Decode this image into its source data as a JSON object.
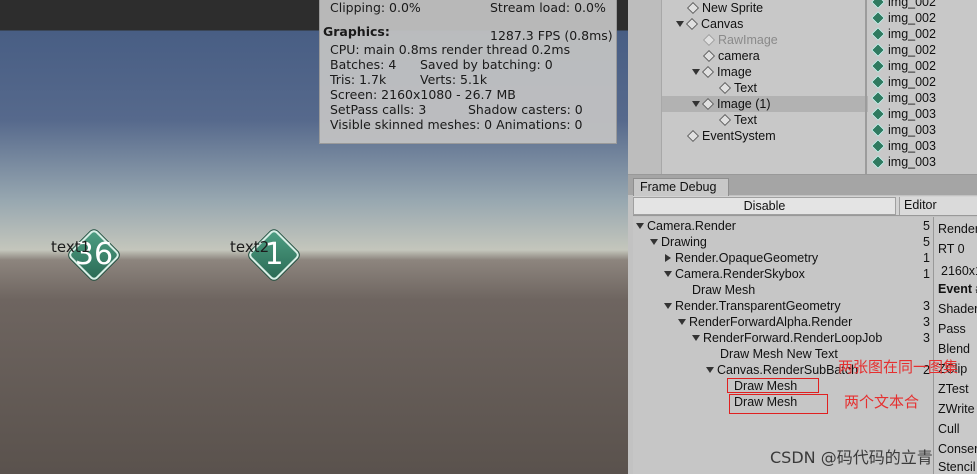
{
  "game": {
    "objects": [
      {
        "label": "text1",
        "number": "36"
      },
      {
        "label": "text2",
        "number": "1"
      }
    ],
    "stats": {
      "clipping": "Clipping: 0.0%",
      "stream_load": "Stream load: 0.0%",
      "heading": "Graphics:",
      "fps": "1287.3 FPS (0.8ms)",
      "cpu": "CPU: main 0.8ms  render thread 0.2ms",
      "batches": "Batches: 4",
      "saved_batching": "Saved by batching: 0",
      "tris": "Tris: 1.7k",
      "verts": "Verts: 5.1k",
      "screen": "Screen: 2160x1080 - 26.7 MB",
      "setpass": "SetPass calls: 3",
      "shadow_casters": "Shadow casters: 0",
      "skinned": "Visible skinned meshes: 0  Animations: 0"
    }
  },
  "hierarchy": {
    "items": [
      {
        "label": "New Sprite",
        "expand": "none",
        "dim": false
      },
      {
        "label": "Canvas",
        "expand": "open",
        "dim": false
      },
      {
        "label": "RawImage",
        "expand": "none",
        "dim": true
      },
      {
        "label": "camera",
        "expand": "none",
        "dim": false
      },
      {
        "label": "Image",
        "expand": "open",
        "dim": false
      },
      {
        "label": "Text",
        "expand": "none",
        "dim": false
      },
      {
        "label": "Image (1)",
        "expand": "open",
        "dim": false
      },
      {
        "label": "Text",
        "expand": "none",
        "dim": false
      },
      {
        "label": "EventSystem",
        "expand": "none",
        "dim": false
      }
    ],
    "assets": [
      "img_002",
      "img_002",
      "img_002",
      "img_002",
      "img_002",
      "img_002",
      "img_003",
      "img_003",
      "img_003",
      "img_003",
      "img_003"
    ]
  },
  "frame_debug": {
    "tab": "Frame Debug",
    "disable_label": "Disable",
    "editor_label": "Editor",
    "tree": [
      {
        "label": "Camera.Render",
        "count": "5",
        "expand": "open"
      },
      {
        "label": "Drawing",
        "count": "5",
        "expand": "open"
      },
      {
        "label": "Render.OpaqueGeometry",
        "count": "1",
        "expand": "closed"
      },
      {
        "label": "Camera.RenderSkybox",
        "count": "1",
        "expand": "open"
      },
      {
        "label": "Draw Mesh",
        "count": "",
        "expand": "none"
      },
      {
        "label": "Render.TransparentGeometry",
        "count": "3",
        "expand": "open"
      },
      {
        "label": "RenderForwardAlpha.Render",
        "count": "3",
        "expand": "open"
      },
      {
        "label": "RenderForward.RenderLoopJob",
        "count": "3",
        "expand": "open"
      },
      {
        "label": "Draw Mesh New Text",
        "count": "",
        "expand": "none"
      },
      {
        "label": "Canvas.RenderSubBatch",
        "count": "2",
        "expand": "open"
      },
      {
        "label": "Draw Mesh",
        "count": "",
        "expand": "none"
      },
      {
        "label": "Draw Mesh",
        "count": "",
        "expand": "none"
      }
    ],
    "details": [
      "Render",
      "RT 0",
      "2160x1",
      "Event #",
      "Shader",
      "Pass",
      "Blend",
      "ZClip",
      "ZTest",
      "ZWrite",
      "Cull",
      "Conser",
      "Stencil"
    ]
  },
  "annotations": {
    "note1": "两张图在同一图集",
    "note2": "两个文本合"
  },
  "watermark": "CSDN @码代码的立青"
}
